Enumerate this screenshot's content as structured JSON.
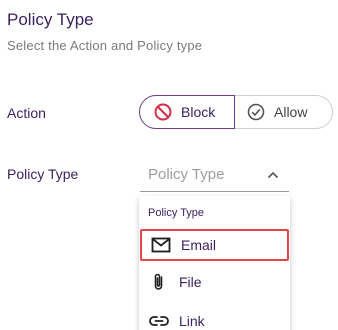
{
  "header": {
    "title": "Policy Type",
    "subtitle": "Select the Action and Policy type"
  },
  "action": {
    "label": "Action",
    "options": [
      {
        "label": "Block",
        "icon": "block-icon",
        "selected": true
      },
      {
        "label": "Allow",
        "icon": "check-circle-icon",
        "selected": false
      }
    ]
  },
  "policy_type": {
    "label": "Policy Type",
    "placeholder": "Policy Type",
    "expanded": true,
    "menu_header": "Policy Type",
    "options": [
      {
        "label": "Email",
        "icon": "email-icon",
        "highlighted": true
      },
      {
        "label": "File",
        "icon": "paperclip-icon",
        "highlighted": false
      },
      {
        "label": "Link",
        "icon": "link-icon",
        "highlighted": false
      }
    ]
  },
  "colors": {
    "accent": "#6b3f8a",
    "block_icon": "#d32f4a",
    "highlight_border": "#e0474c",
    "text": "#3b1f5e"
  }
}
